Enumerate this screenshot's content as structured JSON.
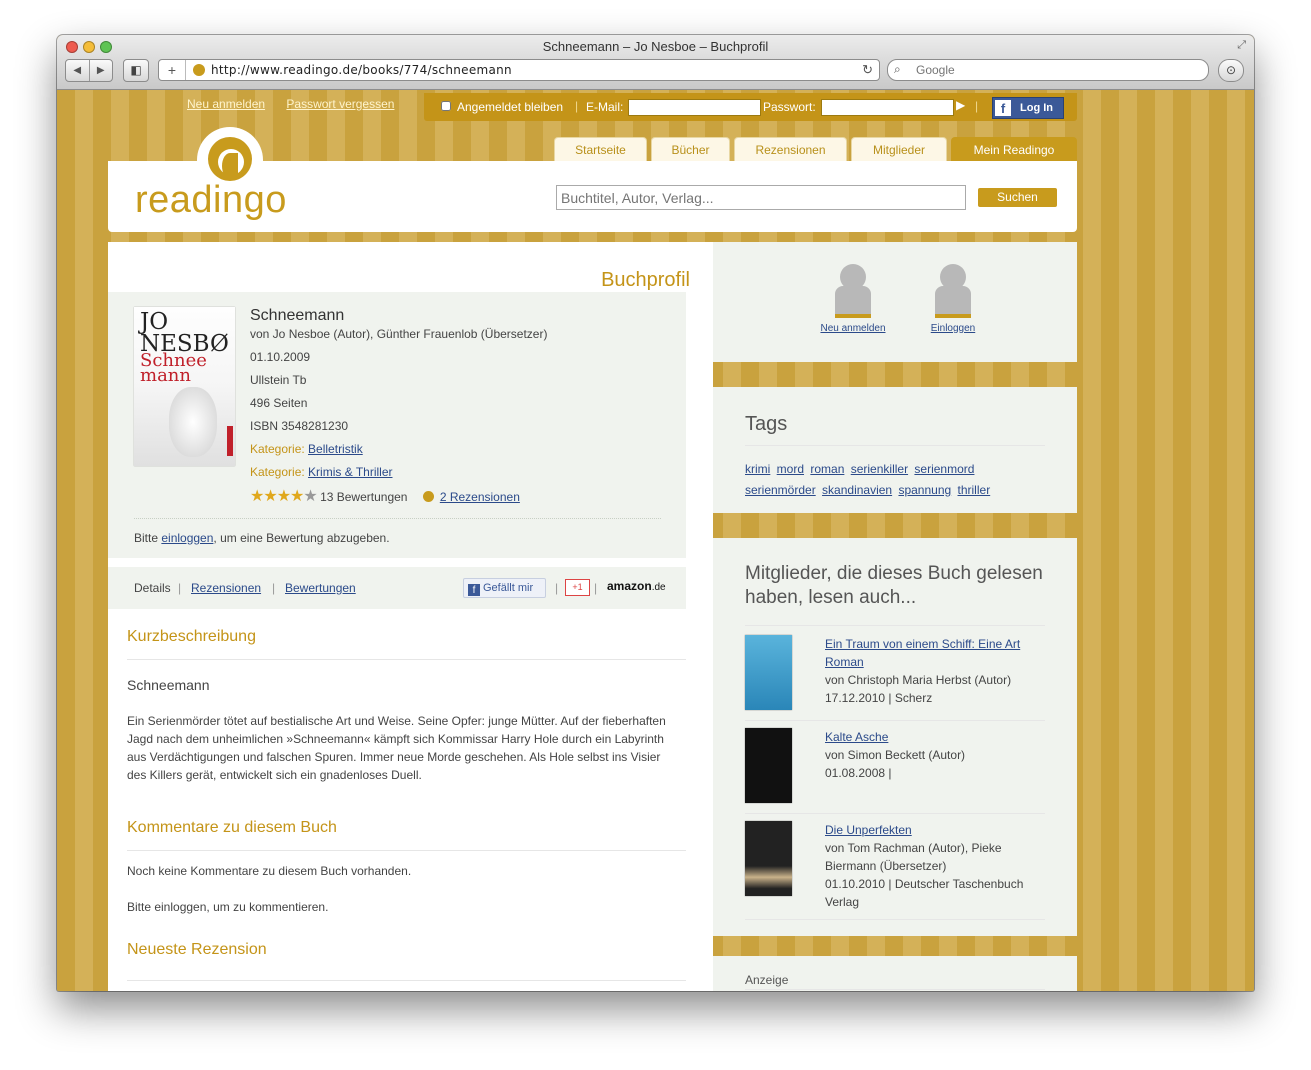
{
  "window": {
    "title": "Schneemann – Jo Nesboe – Buchprofil",
    "url": "http://www.readingo.de/books/774/schneemann",
    "search_placeholder": "Google"
  },
  "topbar": {
    "links": [
      "Neu anmelden",
      "Passwort vergessen"
    ],
    "remember": "Angemeldet bleiben",
    "email_label": "E-Mail:",
    "password_label": "Passwort:",
    "fb_login": "Log In"
  },
  "nav": {
    "tabs": [
      "Startseite",
      "Bücher",
      "Rezensionen",
      "Mitglieder",
      "Mein Readingo"
    ]
  },
  "header": {
    "logo": "readingo",
    "search_placeholder": "Buchtitel, Autor, Verlag...",
    "search_button": "Suchen"
  },
  "book": {
    "page_title": "Buchprofil",
    "cover": {
      "author": "JO NESBØ",
      "title": "Schnee mann"
    },
    "title": "Schneemann",
    "by": "von Jo Nesboe (Autor), Günther Frauenlob (Übersetzer)",
    "date": "01.10.2009",
    "publisher": "Ullstein Tb",
    "pages": "496 Seiten",
    "isbn": "ISBN 3548281230",
    "category_label": "Kategorie:",
    "category1": "Belletristik",
    "category2": "Krimis & Thriller",
    "rating": 4.5,
    "ratings": "13 Bewertungen",
    "reviews": "2 Rezensionen",
    "rate_prefix": "Bitte ",
    "rate_link": "einloggen",
    "rate_suffix": ", um eine Bewertung abzugeben."
  },
  "detailbar": {
    "details": "Details",
    "rezensionen": "Rezensionen",
    "bewertungen": "Bewertungen",
    "like": "Gefällt mir",
    "gplus": "+1",
    "amazon": "amazon",
    "amazon_tld": ".de"
  },
  "kurz": {
    "heading": "Kurzbeschreibung",
    "subtitle": "Schneemann",
    "text": "Ein Serienmörder tötet auf bestialische Art und Weise. Seine Opfer: junge Mütter. Auf der fieberhaften Jagd nach dem unheimlichen »Schneemann« kämpft sich Kommissar Harry Hole durch ein Labyrinth aus Verdächtigungen und falschen Spuren. Immer neue Morde geschehen. Als Hole selbst ins Visier des Killers gerät, entwickelt sich ein gnadenloses Duell."
  },
  "kommentare": {
    "heading": "Kommentare zu diesem Buch",
    "none": "Noch keine Kommentare zu diesem Buch vorhanden.",
    "login": "Bitte einloggen, um zu kommentieren."
  },
  "neueste": {
    "heading": "Neueste Rezension"
  },
  "sidebar": {
    "register": "Neu anmelden",
    "login": "Einloggen",
    "tags_heading": "Tags",
    "tags": [
      "krimi",
      "mord",
      "roman",
      "serienkiller",
      "serienmord",
      "serienmörder",
      "skandinavien",
      "spannung",
      "thriller"
    ],
    "also_heading": "Mitglieder, die dieses Buch gelesen haben, lesen auch...",
    "also": [
      {
        "title": "Ein Traum von einem Schiff: Eine Art Roman",
        "by": "von Christoph Maria Herbst (Autor)",
        "meta": "17.12.2010 | Scherz"
      },
      {
        "title": "Kalte Asche",
        "by": "von Simon Beckett (Autor)",
        "meta": "01.08.2008 |"
      },
      {
        "title": "Die Unperfekten",
        "by": "von Tom Rachman (Autor), Pieke Biermann (Übersetzer)",
        "meta": "01.10.2010 | Deutscher Taschenbuch Verlag"
      }
    ],
    "ad": "Anzeige"
  }
}
